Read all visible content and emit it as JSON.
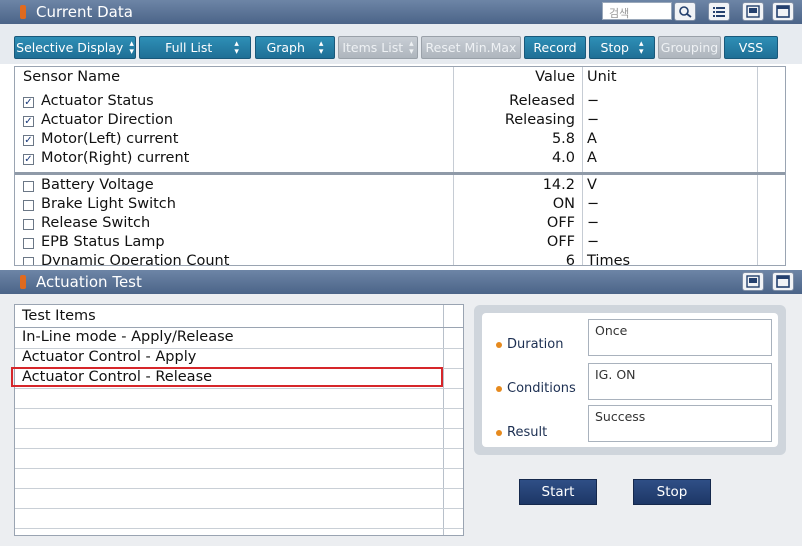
{
  "current_data": {
    "title": "Current Data",
    "search_placeholder": "검색"
  },
  "toolbar": {
    "buttons": [
      {
        "label": "Selective Display",
        "dropdown": true,
        "enabled": true
      },
      {
        "label": "Full List",
        "dropdown": true,
        "enabled": true
      },
      {
        "label": "Graph",
        "dropdown": true,
        "enabled": true
      },
      {
        "label": "Items List",
        "dropdown": true,
        "enabled": false
      },
      {
        "label": "Reset Min.Max",
        "dropdown": false,
        "enabled": false
      },
      {
        "label": "Record",
        "dropdown": false,
        "enabled": true
      },
      {
        "label": "Stop",
        "dropdown": true,
        "enabled": true
      },
      {
        "label": "Grouping",
        "dropdown": false,
        "enabled": false
      },
      {
        "label": "VSS",
        "dropdown": false,
        "enabled": true
      }
    ]
  },
  "sensor_table": {
    "columns": {
      "name": "Sensor Name",
      "value": "Value",
      "unit": "Unit"
    },
    "rows": [
      {
        "name": "Actuator Status",
        "value": "Released",
        "unit": "−",
        "checked": true
      },
      {
        "name": "Actuator Direction",
        "value": "Releasing",
        "unit": "−",
        "checked": true
      },
      {
        "name": "Motor(Left) current",
        "value": "5.8",
        "unit": "A",
        "checked": true
      },
      {
        "name": "Motor(Right) current",
        "value": "4.0",
        "unit": "A",
        "checked": true
      },
      {
        "name": "Battery Voltage",
        "value": "14.2",
        "unit": "V",
        "checked": false
      },
      {
        "name": "Brake Light Switch",
        "value": "ON",
        "unit": "−",
        "checked": false
      },
      {
        "name": "Release Switch",
        "value": "OFF",
        "unit": "−",
        "checked": false
      },
      {
        "name": "EPB Status Lamp",
        "value": "OFF",
        "unit": "−",
        "checked": false
      },
      {
        "name": "Dynamic Operation Count",
        "value": "6",
        "unit": "Times",
        "checked": false
      }
    ]
  },
  "actuation": {
    "title": "Actuation Test",
    "test_items_header": "Test Items",
    "items": [
      "In-Line mode - Apply/Release",
      "Actuator Control - Apply",
      "Actuator Control - Release"
    ],
    "selected_index": 2,
    "info": {
      "duration_label": "Duration",
      "duration_value": "Once",
      "conditions_label": "Conditions",
      "conditions_value": "IG. ON",
      "result_label": "Result",
      "result_value": "Success"
    },
    "start_label": "Start",
    "stop_label": "Stop"
  },
  "colors": {
    "titlebar": "#5a7397",
    "toolbar_button": "#2680aa",
    "disabled_button": "#b9c0c8",
    "selection_outline": "#d6262a",
    "action_button": "#274677"
  }
}
